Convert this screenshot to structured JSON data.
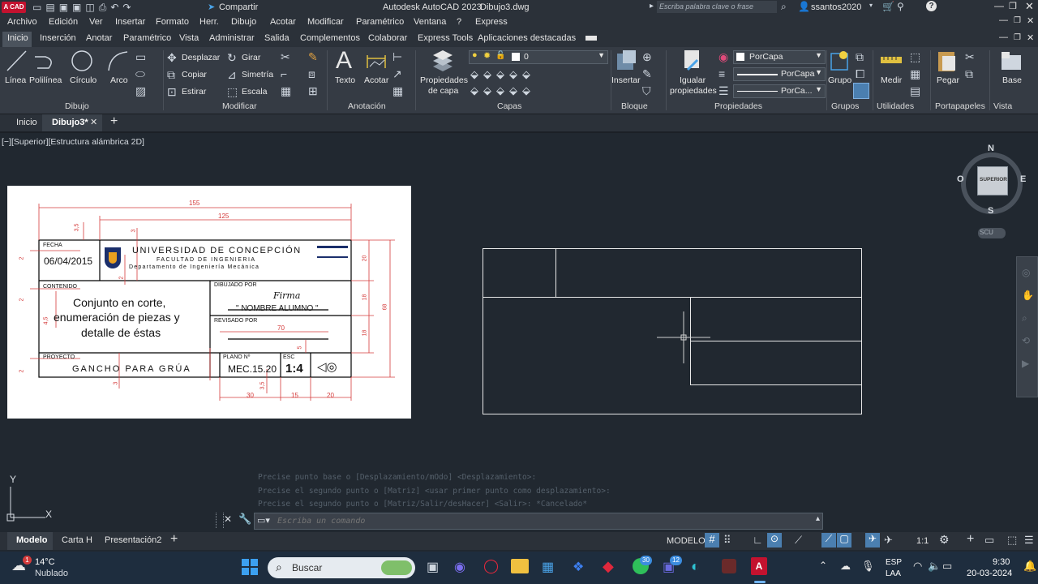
{
  "title_bar": {
    "share_label": "Compartir",
    "app_title": "Autodesk AutoCAD 2023",
    "file_title": "Dibujo3.dwg",
    "search_placeholder": "Escriba palabra clave o frase",
    "user": "ssantos2020"
  },
  "menu": [
    "Archivo",
    "Edición",
    "Ver",
    "Insertar",
    "Formato",
    "Herr.",
    "Dibujo",
    "Acotar",
    "Modificar",
    "Paramétrico",
    "Ventana",
    "?",
    "Express"
  ],
  "ribbon_tabs": [
    "Inicio",
    "Inserción",
    "Anotar",
    "Paramétrico",
    "Vista",
    "Administrar",
    "Salida",
    "Complementos",
    "Colaborar",
    "Express Tools",
    "Aplicaciones destacadas"
  ],
  "ribbon": {
    "draw": [
      "Línea",
      "Polilínea",
      "Círculo",
      "Arco"
    ],
    "modify": [
      "Desplazar",
      "Girar",
      "Copiar",
      "Simetría",
      "Estirar",
      "Escala"
    ],
    "annotation": [
      "Texto",
      "Acotar"
    ],
    "layers": {
      "props": "Propiedades",
      "props2": "de capa",
      "current": "0"
    },
    "block": {
      "insert": "Insertar"
    },
    "properties": {
      "match": "Igualar",
      "match2": "propiedades",
      "color": "PorCapa",
      "linetype": "PorCapa",
      "lineweight": "PorCa..."
    },
    "groups": {
      "group": "Grupo"
    },
    "utilities": {
      "measure": "Medir"
    },
    "clipboard": {
      "paste": "Pegar"
    },
    "view": {
      "base": "Base"
    },
    "panels": [
      "Dibujo",
      "Modificar",
      "Anotación",
      "Capas",
      "Bloque",
      "Propiedades",
      "Grupos",
      "Utilidades",
      "Portapapeles",
      "Vista"
    ]
  },
  "doc_tabs": [
    "Inicio",
    "Dibujo3*"
  ],
  "viewport_label": "[−][Superior][Estructura alámbrica 2D]",
  "viewcube": {
    "n": "N",
    "s": "S",
    "e": "E",
    "w": "O",
    "face": "SUPERIOR",
    "ucs": "SCU"
  },
  "ucs": {
    "x": "X",
    "y": "Y"
  },
  "title_block": {
    "fecha_label": "FECHA",
    "fecha": "06/04/2015",
    "university": "UNIVERSIDAD DE CONCEPCIÓN",
    "faculty": "FACULTAD DE INGENIERIA",
    "department": "Departamento de Ingeniería Mecánica",
    "contenido_label": "CONTENIDO",
    "contenido_1": "Conjunto en corte,",
    "contenido_2": "enumeración de piezas y",
    "contenido_3": "detalle de éstas",
    "dibujado_label": "DIBUJADO POR",
    "firma": "Firma",
    "alumno": "\" NOMBRE ALUMNO \"",
    "revisado_label": "REVISADO POR",
    "proyecto_label": "PROYECTO",
    "proyecto": "GANCHO PARA GRÚA",
    "plano_label": "PLANO Nº",
    "plano": "MEC.15.20",
    "esc_label": "ESC",
    "esc": "1:4",
    "dims": {
      "d155": "155",
      "d125": "125",
      "d35a": "3,5",
      "d3a": "3",
      "d2a": "2",
      "d20": "20",
      "d18a": "18",
      "d18b": "18",
      "d68": "68",
      "d70": "70",
      "d5": "5",
      "d45": "4,5",
      "d2b": "2",
      "d2c": "2",
      "d3b": "3",
      "d2d": "2",
      "d30": "30",
      "d35b": "3,5",
      "d15": "15",
      "d20b": "20"
    }
  },
  "command_history": [
    "Precise punto base o [Desplazamiento/mOdo] <Desplazamiento>:",
    "Precise el segundo punto o [Matriz] <usar primer punto como desplazamiento>:",
    "Precise el segundo punto o [Matriz/Salir/desHacer] <Salir>: *Cancelado*"
  ],
  "command_placeholder": "Escriba un comando",
  "layout_tabs": [
    "Modelo",
    "Carta H",
    "Presentación2"
  ],
  "status": {
    "mode": "MODELO",
    "scale": "1:1"
  },
  "taskbar": {
    "temp": "14°C",
    "weather": "Nublado",
    "weather_badge": "1",
    "search": "Buscar",
    "whatsapp_badge": "30",
    "teams_badge": "12",
    "lang1": "ESP",
    "lang2": "LAA",
    "time": "9:30",
    "date": "20-03-2024"
  }
}
